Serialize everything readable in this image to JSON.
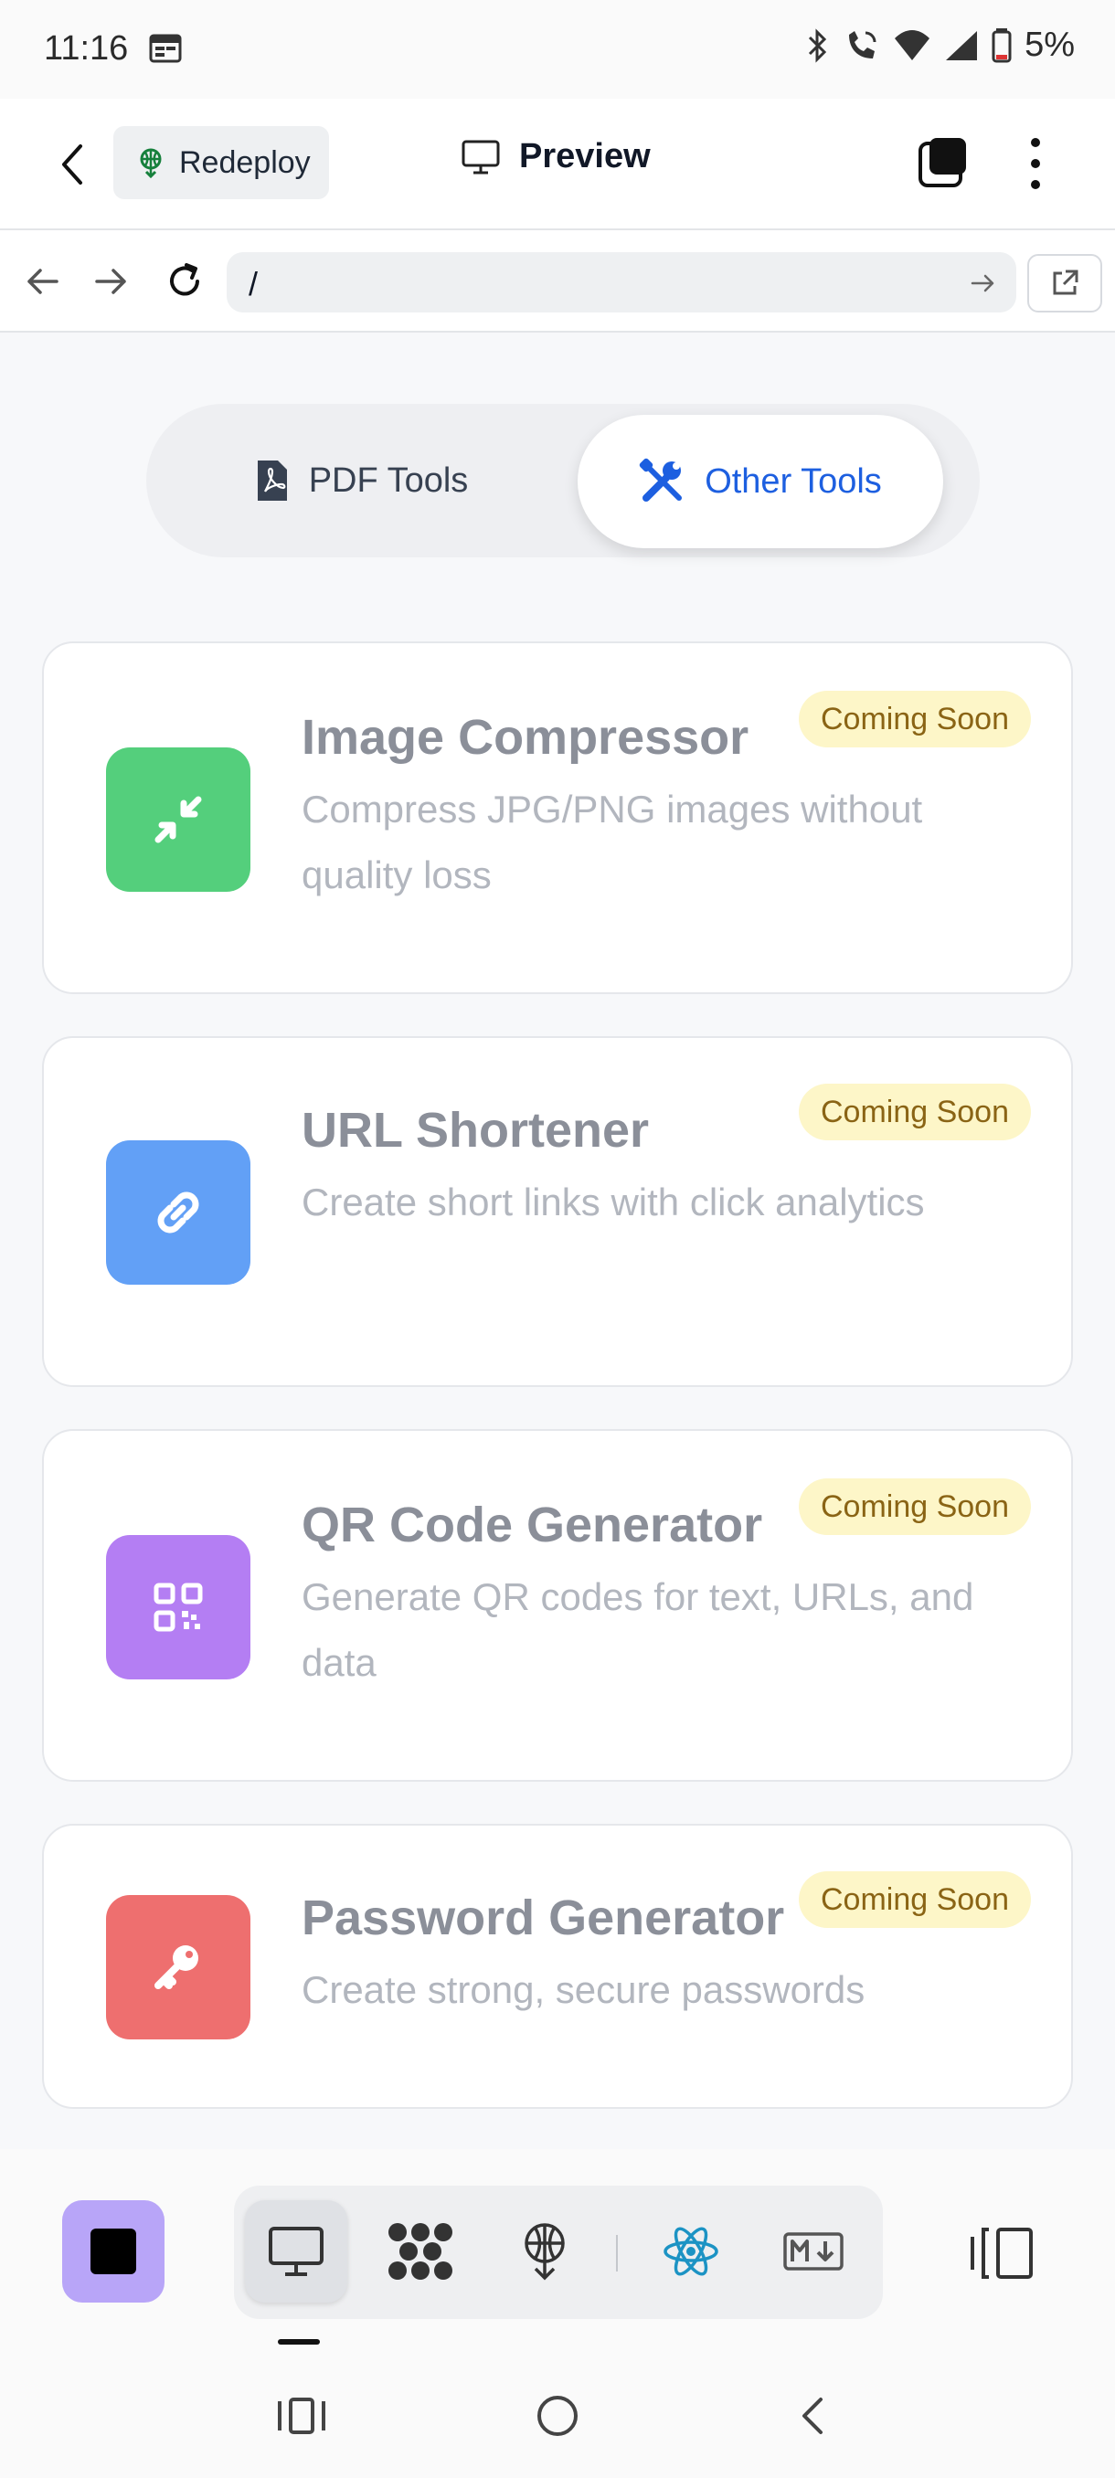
{
  "status_bar": {
    "time": "11:16",
    "battery": "5%",
    "icons": [
      "calendar-icon",
      "bluetooth-icon",
      "wifi-calling-icon",
      "wifi-icon",
      "signal-icon",
      "battery-icon"
    ]
  },
  "header": {
    "redeploy_label": "Redeploy",
    "preview_label": "Preview"
  },
  "url_bar": {
    "value": "/"
  },
  "segmented_control": {
    "tabs": [
      {
        "label": "PDF Tools",
        "active": false
      },
      {
        "label": "Other Tools",
        "active": true
      }
    ]
  },
  "tools": [
    {
      "title": "Image Compressor",
      "description": "Compress JPG/PNG images without quality loss",
      "badge": "Coming Soon",
      "icon": "compress-icon",
      "color": "#54cf7c"
    },
    {
      "title": "URL Shortener",
      "description": "Create short links with click analytics",
      "badge": "Coming Soon",
      "icon": "link-icon",
      "color": "#62a0f6"
    },
    {
      "title": "QR Code Generator",
      "description": "Generate QR codes for text, URLs, and data",
      "badge": "Coming Soon",
      "icon": "qr-code-icon",
      "color": "#b47ef3"
    },
    {
      "title": "Password Generator",
      "description": "Create strong, secure passwords",
      "badge": "Coming Soon",
      "icon": "key-icon",
      "color": "#ee6f6f"
    }
  ],
  "toolbar": {
    "items": [
      "preview-icon",
      "nodes-icon",
      "deploy-icon",
      "react-icon",
      "markdown-icon"
    ],
    "active": "preview-icon"
  },
  "colors": {
    "accent": "#1d5fe0",
    "badge_bg": "#fdf6c8",
    "badge_text": "#8a6415"
  }
}
